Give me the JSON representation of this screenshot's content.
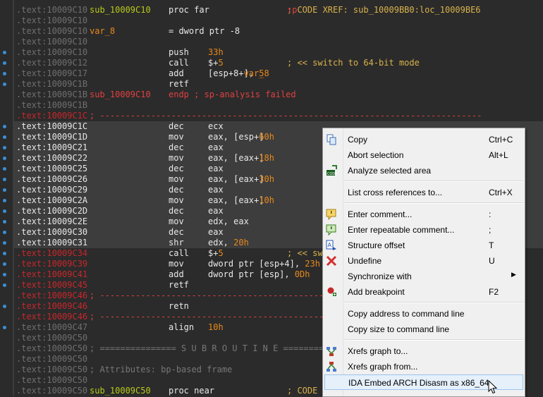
{
  "listing": [
    {
      "addr": ".text:10009C10",
      "label": "sub_10009C10",
      "label_style": "green",
      "mn": "proc far",
      "cm": "; CODE XREF: sub_10009BB0:loc_10009BE6",
      "cm_suffix": "↑p"
    },
    {
      "addr": ".text:10009C10"
    },
    {
      "addr": ".text:10009C10",
      "label": "var_8",
      "label_style": "orange",
      "mn": "= dword ptr -8"
    },
    {
      "addr": ".text:10009C10"
    },
    {
      "addr": ".text:10009C10",
      "mn": "push",
      "op": "33h",
      "op_style": "num"
    },
    {
      "addr": ".text:10009C12",
      "mn": "call",
      "op": "$+5",
      "cm": "; << switch to 64-bit mode"
    },
    {
      "addr": ".text:10009C17",
      "mn": "add",
      "op": "[esp+8+var_8], 5"
    },
    {
      "addr": ".text:10009C1B",
      "mn": "retf"
    },
    {
      "addr": ".text:10009C1B",
      "label": "sub_10009C10",
      "label_style": "red",
      "mn": "endp ; sp-analysis failed",
      "mn_style": "red"
    },
    {
      "addr": ".text:10009C1B"
    },
    {
      "addr": ".text:10009C1C",
      "addr_style": "red",
      "full": "; ---------------------------------------------------------------------------"
    },
    {
      "addr": ".text:10009C1C",
      "addr_style": "red",
      "sel": true,
      "mn": "dec",
      "op": "ecx"
    },
    {
      "addr": ".text:10009C1D",
      "sel": true,
      "mn": "mov",
      "op": "eax, [esp+60h]"
    },
    {
      "addr": ".text:10009C21",
      "sel": true,
      "mn": "dec",
      "op": "eax"
    },
    {
      "addr": ".text:10009C22",
      "sel": true,
      "mn": "mov",
      "op": "eax, [eax+18h]"
    },
    {
      "addr": ".text:10009C25",
      "sel": true,
      "mn": "dec",
      "op": "eax"
    },
    {
      "addr": ".text:10009C26",
      "sel": true,
      "mn": "mov",
      "op": "eax, [eax+30h]"
    },
    {
      "addr": ".text:10009C29",
      "sel": true,
      "mn": "dec",
      "op": "eax"
    },
    {
      "addr": ".text:10009C2A",
      "sel": true,
      "mn": "mov",
      "op": "eax, [eax+10h]"
    },
    {
      "addr": ".text:10009C2D",
      "sel": true,
      "mn": "dec",
      "op": "eax"
    },
    {
      "addr": ".text:10009C2E",
      "sel": true,
      "mn": "mov",
      "op": "edx, eax"
    },
    {
      "addr": ".text:10009C30",
      "sel": true,
      "mn": "dec",
      "op": "eax"
    },
    {
      "addr": ".text:10009C31",
      "sel": true,
      "mn": "shr",
      "op": "edx, 20h"
    },
    {
      "addr": ".text:10009C34",
      "addr_style": "red",
      "mn": "call",
      "op": "$+5",
      "cm": "; << sw"
    },
    {
      "addr": ".text:10009C39",
      "addr_style": "red",
      "mn": "mov",
      "op": "dword ptr [esp+4], 23h"
    },
    {
      "addr": ".text:10009C41",
      "addr_style": "red",
      "mn": "add",
      "op": "dword ptr [esp], 0Dh"
    },
    {
      "addr": ".text:10009C45",
      "addr_style": "red",
      "mn": "retf"
    },
    {
      "addr": ".text:10009C46",
      "addr_style": "red",
      "full": "; ---------------------------------------------------------------------------"
    },
    {
      "addr": ".text:10009C46",
      "addr_style": "red",
      "mn": "retn"
    },
    {
      "addr": ".text:10009C46",
      "addr_style": "red",
      "full": "; ---------------------------------------------------------------------------"
    },
    {
      "addr": ".text:10009C47",
      "mn": "align",
      "op": "10h",
      "op_style": "num"
    },
    {
      "addr": ".text:10009C50"
    },
    {
      "addr": ".text:10009C50",
      "full": "; =============== S U B R O U T I N E ======================================="
    },
    {
      "addr": ".text:10009C50"
    },
    {
      "addr": ".text:10009C50",
      "full": "; Attributes: bp-based frame"
    },
    {
      "addr": ".text:10009C50"
    },
    {
      "addr": ".text:10009C50",
      "label": "sub_10009C50",
      "label_style": "green",
      "mn": "proc near",
      "cm": "; CODE XR"
    }
  ],
  "menu": {
    "items": [
      {
        "id": "copy",
        "label": "Copy",
        "shortcut": "Ctrl+C",
        "icon": "copy-icon"
      },
      {
        "id": "abort-selection",
        "label": "Abort selection",
        "shortcut": "Alt+L"
      },
      {
        "id": "analyze-selected-area",
        "label": "Analyze selected area",
        "shortcut": "",
        "icon": "code-analyze-icon"
      },
      {
        "sep": true
      },
      {
        "id": "list-cross-references",
        "label": "List cross references to...",
        "shortcut": "Ctrl+X"
      },
      {
        "sep": true
      },
      {
        "id": "enter-comment",
        "label": "Enter comment...",
        "shortcut": ":",
        "icon": "comment-icon"
      },
      {
        "id": "enter-repeatable-comment",
        "label": "Enter repeatable comment...",
        "shortcut": ";",
        "icon": "repeatable-comment-icon"
      },
      {
        "id": "structure-offset",
        "label": "Structure offset",
        "shortcut": "T",
        "icon": "structure-offset-icon"
      },
      {
        "id": "undefine",
        "label": "Undefine",
        "shortcut": "U",
        "icon": "undefine-icon"
      },
      {
        "id": "synchronize-with",
        "label": "Synchronize with",
        "shortcut": "",
        "submenu": true
      },
      {
        "id": "add-breakpoint",
        "label": "Add breakpoint",
        "shortcut": "F2",
        "icon": "breakpoint-icon"
      },
      {
        "sep": true
      },
      {
        "id": "copy-address",
        "label": "Copy address to command line",
        "shortcut": ""
      },
      {
        "id": "copy-size",
        "label": "Copy size to command line",
        "shortcut": ""
      },
      {
        "sep": true
      },
      {
        "id": "xrefs-graph-to",
        "label": "Xrefs graph to...",
        "shortcut": "",
        "icon": "xrefs-graph-to-icon"
      },
      {
        "id": "xrefs-graph-from",
        "label": "Xrefs graph from...",
        "shortcut": "",
        "icon": "xrefs-graph-from-icon"
      },
      {
        "id": "ida-embed-arch",
        "label": "IDA Embed ARCH Disasm as x86_64",
        "shortcut": "",
        "highlighted": true
      }
    ]
  },
  "colors": {
    "background": "#2b2b2b",
    "selection": "#3d3d3d",
    "address": "#6f6f6f",
    "address_red": "#c8262b",
    "label": "#b7c91a",
    "number": "#e88a1a",
    "comment": "#d9b24c",
    "menu_bg": "#f0f0f0",
    "menu_highlight": "#e5f0fb"
  }
}
